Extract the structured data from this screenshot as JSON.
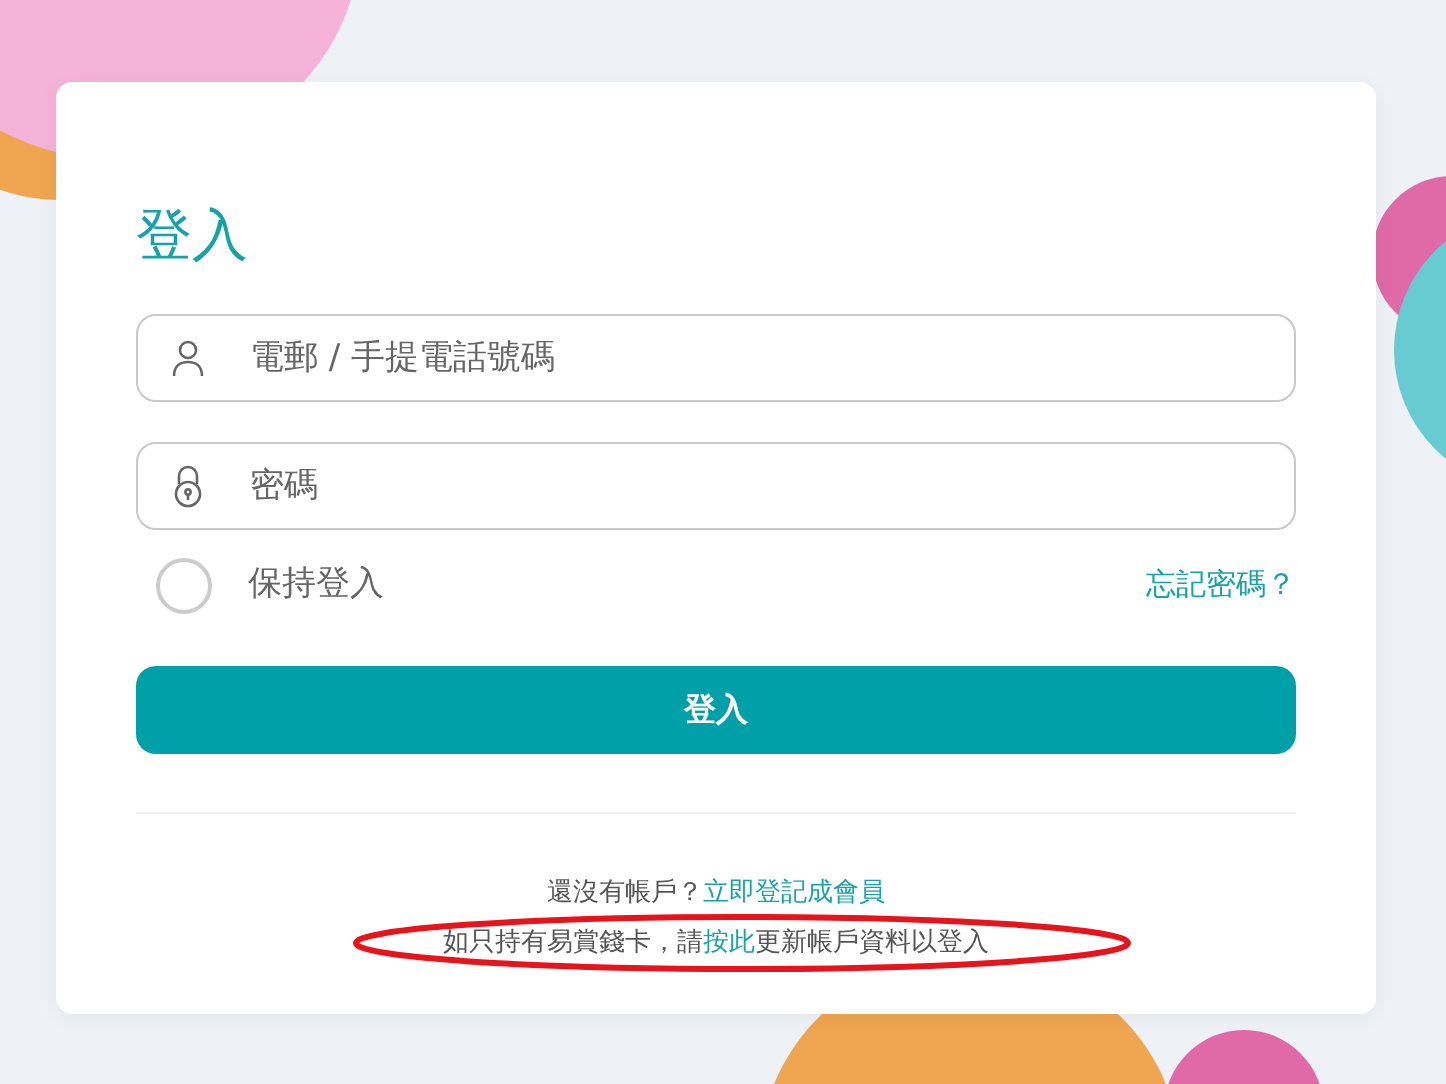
{
  "title": "登入",
  "fields": [
    {
      "kind": "user",
      "placeholder": "電郵 / 手提電話號碼"
    },
    {
      "kind": "password",
      "placeholder": "密碼"
    }
  ],
  "remember": {
    "label": "保持登入",
    "checked": false
  },
  "forgot_link": "忘記密碼？",
  "submit_button": "登入",
  "footer": [
    {
      "before": "還沒有帳戶？",
      "link": "立即登記成會員",
      "annotated": false
    },
    {
      "before": "如只持有易賞錢卡，請",
      "link": "按此",
      "after": "更新帳戶資料以登入",
      "annotated": true
    }
  ]
}
